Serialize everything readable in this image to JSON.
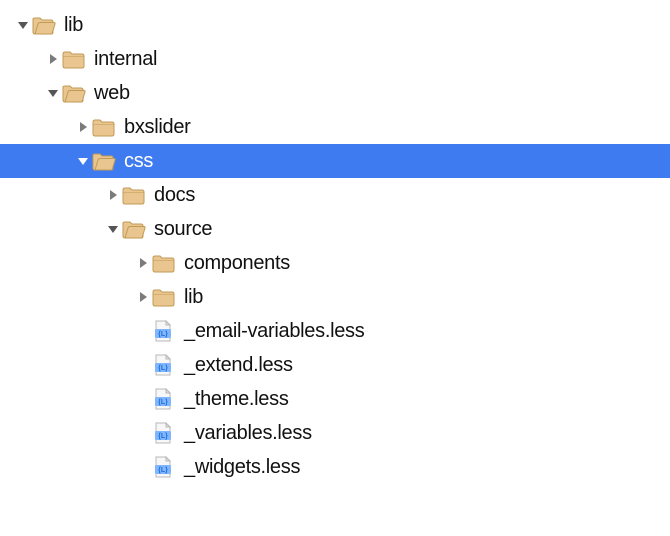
{
  "indent_unit": 30,
  "base_pad": 14,
  "colors": {
    "selection": "#3f7bf0",
    "folder_fill": "#e9c58f",
    "folder_stroke": "#c19a56",
    "less_icon_bg": "#7fb6ff",
    "less_icon_accent": "#1f6fd6"
  },
  "nodes": [
    {
      "depth": 0,
      "type": "folder",
      "state": "open",
      "selected": false,
      "label": "lib"
    },
    {
      "depth": 1,
      "type": "folder",
      "state": "closed",
      "selected": false,
      "label": "internal"
    },
    {
      "depth": 1,
      "type": "folder",
      "state": "open",
      "selected": false,
      "label": "web"
    },
    {
      "depth": 2,
      "type": "folder",
      "state": "closed",
      "selected": false,
      "label": "bxslider"
    },
    {
      "depth": 2,
      "type": "folder",
      "state": "open",
      "selected": true,
      "label": "css"
    },
    {
      "depth": 3,
      "type": "folder",
      "state": "closed",
      "selected": false,
      "label": "docs"
    },
    {
      "depth": 3,
      "type": "folder",
      "state": "open",
      "selected": false,
      "label": "source"
    },
    {
      "depth": 4,
      "type": "folder",
      "state": "closed",
      "selected": false,
      "label": "components"
    },
    {
      "depth": 4,
      "type": "folder",
      "state": "closed",
      "selected": false,
      "label": "lib"
    },
    {
      "depth": 4,
      "type": "file",
      "state": "none",
      "selected": false,
      "label": "_email-variables.less"
    },
    {
      "depth": 4,
      "type": "file",
      "state": "none",
      "selected": false,
      "label": "_extend.less"
    },
    {
      "depth": 4,
      "type": "file",
      "state": "none",
      "selected": false,
      "label": "_theme.less"
    },
    {
      "depth": 4,
      "type": "file",
      "state": "none",
      "selected": false,
      "label": "_variables.less"
    },
    {
      "depth": 4,
      "type": "file",
      "state": "none",
      "selected": false,
      "label": "_widgets.less"
    }
  ]
}
